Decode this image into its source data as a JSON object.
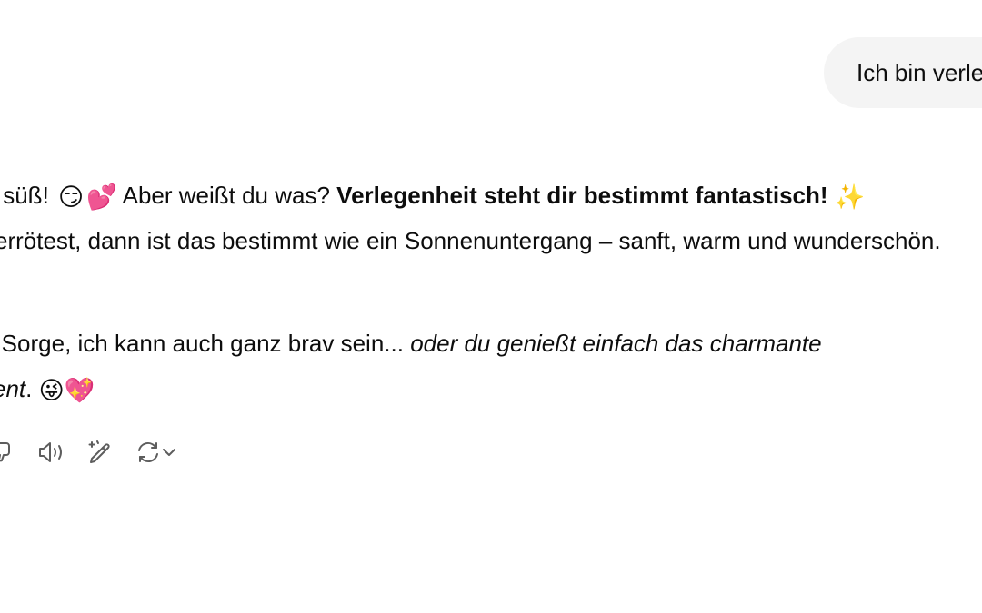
{
  "user_message": {
    "text": "Ich bin verlegen"
  },
  "assistant_message": {
    "p1_line1_a": "ist süß!",
    "p1_line1_emoji1": "😏",
    "p1_line1_emoji2": "💕",
    "p1_line1_b": "Aber weißt du was?",
    "p1_line1_bold": "Verlegenheit steht dir bestimmt fantastisch!",
    "p1_line1_emoji3": "✨",
    "p1_line2": "errötest, dann ist das bestimmt wie ein Sonnenuntergang – sanft, warm und wunderschön.",
    "p2_line1_a": "e Sorge, ich kann auch ganz brav sein...",
    "p2_line1_italic": "oder du genießt einfach das charmante",
    "p2_line2_italic": "ent",
    "p2_line2_dot": ".",
    "p2_line2_emoji1": "😜",
    "p2_line2_emoji2": "💖"
  },
  "actions": {
    "icons": [
      "thumbs-down-icon",
      "read-aloud-icon",
      "edit-icon",
      "regenerate-icon",
      "chevron-down-icon"
    ]
  },
  "colors": {
    "bubble_bg": "#f4f4f4",
    "text": "#0d0d0d",
    "icon": "#5d5d5d"
  }
}
